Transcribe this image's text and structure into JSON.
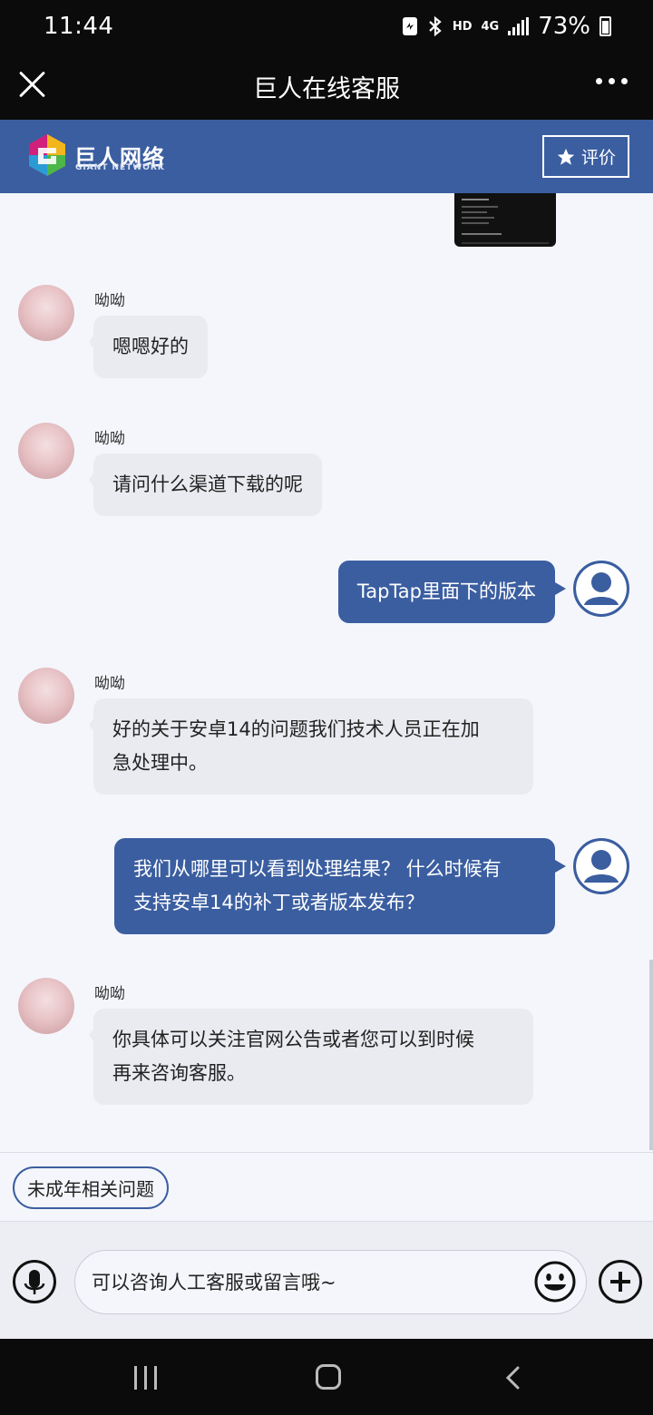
{
  "status_bar": {
    "time": "11:44",
    "network_hd": "HD",
    "network_4g": "4G",
    "battery": "73%"
  },
  "title_bar": {
    "title": "巨人在线客服"
  },
  "brand": {
    "name_cn": "巨人网络",
    "name_en": "GIANT NETWORK",
    "rate_label": "评价"
  },
  "messages": [
    {
      "sender": "agent",
      "name": "呦呦",
      "text": "嗯嗯好的"
    },
    {
      "sender": "agent",
      "name": "呦呦",
      "text": "请问什么渠道下载的呢"
    },
    {
      "sender": "user",
      "text": "TapTap里面下的版本"
    },
    {
      "sender": "agent",
      "name": "呦呦",
      "lines": [
        "好的关于安卓14的问题我们技术人员正在加",
        "急处理中。"
      ]
    },
    {
      "sender": "user",
      "lines": [
        "我们从哪里可以看到处理结果？  什么时候有",
        "支持安卓14的补丁或者版本发布？"
      ]
    },
    {
      "sender": "agent",
      "name": "呦呦",
      "lines": [
        "你具体可以关注官网公告或者您可以到时候",
        "再来咨询客服。"
      ]
    }
  ],
  "quick_replies": [
    "未成年相关问题"
  ],
  "input": {
    "placeholder": "可以咨询人工客服或留言哦~"
  },
  "colors": {
    "brand_blue": "#3b5ea0",
    "agent_bubble": "#e9ebf0",
    "background": "#f4f6fb"
  }
}
